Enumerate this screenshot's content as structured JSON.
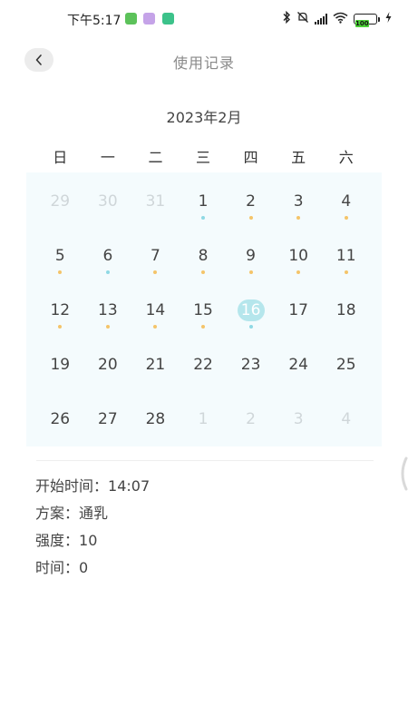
{
  "status_bar": {
    "time": "下午5:17",
    "battery": "100",
    "app_icons": [
      {
        "name": "app-icon-green",
        "color": "#5cc25a"
      },
      {
        "name": "app-icon-purple",
        "color": "#c5a3e8"
      },
      {
        "name": "app-icon-teal",
        "color": "#3cc28a"
      }
    ]
  },
  "header": {
    "title": "使用记录",
    "back_icon": "chevron-left-icon"
  },
  "calendar": {
    "month_label": "2023年2月",
    "weekdays": [
      "日",
      "一",
      "二",
      "三",
      "四",
      "五",
      "六"
    ],
    "colors": {
      "dot_blue": "#8fd9e4",
      "dot_orange": "#f4c46a",
      "today_bg": "#b5e6ec",
      "grid_bg": "#f4fbfd"
    },
    "weeks": [
      [
        {
          "day": "29",
          "other": true,
          "dot": ""
        },
        {
          "day": "30",
          "other": true,
          "dot": ""
        },
        {
          "day": "31",
          "other": true,
          "dot": ""
        },
        {
          "day": "1",
          "other": false,
          "dot": "blue"
        },
        {
          "day": "2",
          "other": false,
          "dot": "orange"
        },
        {
          "day": "3",
          "other": false,
          "dot": "orange"
        },
        {
          "day": "4",
          "other": false,
          "dot": "orange"
        }
      ],
      [
        {
          "day": "5",
          "other": false,
          "dot": "orange"
        },
        {
          "day": "6",
          "other": false,
          "dot": "blue"
        },
        {
          "day": "7",
          "other": false,
          "dot": "orange"
        },
        {
          "day": "8",
          "other": false,
          "dot": "orange"
        },
        {
          "day": "9",
          "other": false,
          "dot": "orange"
        },
        {
          "day": "10",
          "other": false,
          "dot": "orange"
        },
        {
          "day": "11",
          "other": false,
          "dot": "orange"
        }
      ],
      [
        {
          "day": "12",
          "other": false,
          "dot": "orange"
        },
        {
          "day": "13",
          "other": false,
          "dot": "orange"
        },
        {
          "day": "14",
          "other": false,
          "dot": "orange"
        },
        {
          "day": "15",
          "other": false,
          "dot": "orange"
        },
        {
          "day": "16",
          "other": false,
          "dot": "blue",
          "today": true
        },
        {
          "day": "17",
          "other": false,
          "dot": ""
        },
        {
          "day": "18",
          "other": false,
          "dot": ""
        }
      ],
      [
        {
          "day": "19",
          "other": false,
          "dot": ""
        },
        {
          "day": "20",
          "other": false,
          "dot": ""
        },
        {
          "day": "21",
          "other": false,
          "dot": ""
        },
        {
          "day": "22",
          "other": false,
          "dot": ""
        },
        {
          "day": "23",
          "other": false,
          "dot": ""
        },
        {
          "day": "24",
          "other": false,
          "dot": ""
        },
        {
          "day": "25",
          "other": false,
          "dot": ""
        }
      ],
      [
        {
          "day": "26",
          "other": false,
          "dot": ""
        },
        {
          "day": "27",
          "other": false,
          "dot": ""
        },
        {
          "day": "28",
          "other": false,
          "dot": ""
        },
        {
          "day": "1",
          "other": true,
          "dot": ""
        },
        {
          "day": "2",
          "other": true,
          "dot": ""
        },
        {
          "day": "3",
          "other": true,
          "dot": ""
        },
        {
          "day": "4",
          "other": true,
          "dot": ""
        }
      ]
    ]
  },
  "record": {
    "start_time_label": "开始时间：",
    "start_time_value": "14:07",
    "plan_label": "方案：",
    "plan_value": "通乳",
    "intensity_label": "强度：",
    "intensity_value": "10",
    "duration_label": "时间：",
    "duration_value": "0"
  }
}
